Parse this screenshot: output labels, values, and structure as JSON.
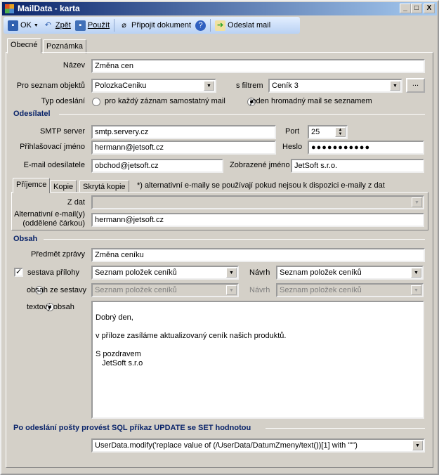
{
  "window": {
    "title": "MailData - karta",
    "min": "_",
    "max": "□",
    "close": "X"
  },
  "toolbar": {
    "ok": "OK",
    "back": "Zpět",
    "apply": "Použít",
    "attach": "Připojit dokument",
    "send": "Odeslat mail"
  },
  "tabs": [
    "Obecné",
    "Poznámka"
  ],
  "form": {
    "name_label": "Název",
    "name": "Změna cen",
    "list_label": "Pro seznam objektů",
    "list": "PolozkaCeniku",
    "filter_label": "s filtrem",
    "filter": "Ceník 3",
    "more": "...",
    "send_type_label": "Typ odeslání",
    "send_type_opt1": "pro každý záznam samostatný mail",
    "send_type_opt2": "jeden hromadný mail se seznamem",
    "send_type_selected": 2
  },
  "sender": {
    "heading": "Odesílatel",
    "smtp_label": "SMTP server",
    "smtp": "smtp.servery.cz",
    "port_label": "Port",
    "port": "25",
    "login_label": "Přihlašovací jméno",
    "login": "hermann@jetsoft.cz",
    "pass_label": "Heslo",
    "pass": "●●●●●●●●●●●",
    "email_label": "E-mail odesílatele",
    "email": "obchod@jetsoft.cz",
    "display_label": "Zobrazené jméno",
    "display": "JetSoft s.r.o."
  },
  "recipients": {
    "tabs": [
      "Příjemce",
      "Kopie",
      "Skrytá kopie"
    ],
    "note": "*) alternativní e-maily se používají pokud nejsou k dispozici e-maily z dat",
    "from_data_label": "Z dat",
    "alt_label1": "Alternativní e-mail(y)",
    "alt_label2": "(oddělené čárkou)",
    "alt": "hermann@jetsoft.cz"
  },
  "content": {
    "heading": "Obsah",
    "subject_label": "Předmět zprávy",
    "subject": "Změna ceníku",
    "attach_label": "sestava přílohy",
    "attach": "Seznam položek ceníků",
    "design_label": "Návrh",
    "design": "Seznam položek ceníků",
    "report_label": "obsah ze sestavy",
    "report": "Seznam položek ceníků",
    "report_design": "Seznam položek ceníků",
    "text_label": "textový obsah",
    "body": [
      "Dobrý den,",
      "",
      "v příloze zasíláme aktualizovaný ceník našich produktů.",
      "",
      "S pozdravem",
      "   JetSoft s.r.o"
    ]
  },
  "sql": {
    "heading": "Po odeslání pošty provést SQL příkaz UPDATE se SET hodnotou",
    "value": "UserData.modify('replace value of (/UserData/DatumZmeny/text())[1] with \"\"')"
  }
}
